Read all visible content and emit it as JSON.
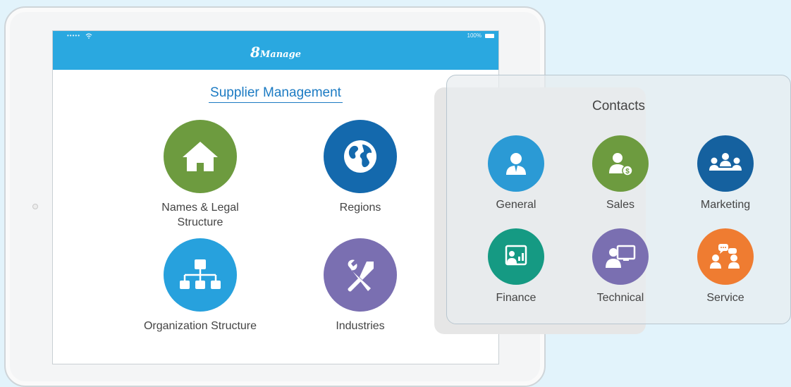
{
  "status_bar": {
    "signal": "••••• ",
    "battery_percent": "100%"
  },
  "app": {
    "logo_big": "8",
    "logo_small": "Manage"
  },
  "supplier": {
    "title": "Supplier Management",
    "tiles": [
      {
        "label_line1": "Names & Legal",
        "label_line2": "Structure",
        "icon": "house-icon",
        "color": "#6d9b3f"
      },
      {
        "label_line1": "Regions",
        "icon": "globe-icon",
        "color": "#1469ad"
      },
      {
        "label_line1": "Organization Structure",
        "icon": "org-chart-icon",
        "color": "#27a1dd"
      },
      {
        "label_line1": "Industries",
        "icon": "tools-icon",
        "color": "#7a6fb1"
      }
    ]
  },
  "contacts": {
    "title": "Contacts",
    "items": [
      {
        "label": "General",
        "icon": "person-icon",
        "color": "#2b9ad5"
      },
      {
        "label": "Sales",
        "icon": "salesperson-icon",
        "color": "#6d9b3f"
      },
      {
        "label": "Marketing",
        "icon": "meeting-icon",
        "color": "#15619f"
      },
      {
        "label": "Finance",
        "icon": "presentation-icon",
        "color": "#159a83"
      },
      {
        "label": "Technical",
        "icon": "computer-user-icon",
        "color": "#7a6fb1"
      },
      {
        "label": "Service",
        "icon": "chat-people-icon",
        "color": "#ef7c31"
      }
    ]
  }
}
